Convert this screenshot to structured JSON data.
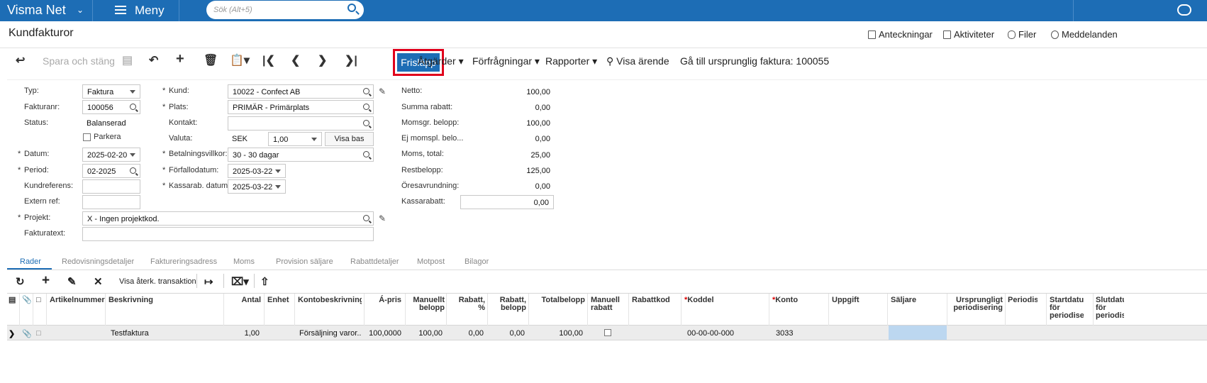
{
  "topbar": {
    "brand": "Visma Net",
    "menu_label": "Meny",
    "search_placeholder": "Sök (Alt+5)"
  },
  "page": {
    "title": "Kundfakturor",
    "links": [
      "Anteckningar",
      "Aktiviteter",
      "Filer",
      "Meddelanden"
    ]
  },
  "toolbar": {
    "save_close": "Spara och stäng",
    "release": "Frisläpp",
    "actions": "Åtgärder",
    "inquiries": "Förfrågningar",
    "reports": "Rapporter",
    "view_case": "Visa ärende",
    "goto_original": "Gå till ursprunglig faktura: 100055"
  },
  "form": {
    "typ_label": "Typ:",
    "typ_value": "Faktura",
    "fakturanr_label": "Fakturanr:",
    "fakturanr_value": "100056",
    "status_label": "Status:",
    "status_value": "Balanserad",
    "parkera_label": "Parkera",
    "datum_label": "Datum:",
    "datum_value": "2025-02-20",
    "period_label": "Period:",
    "period_value": "02-2025",
    "kundref_label": "Kundreferens:",
    "kundref_value": "",
    "extref_label": "Extern ref:",
    "extref_value": "",
    "projekt_label": "Projekt:",
    "projekt_value": "X - Ingen projektkod.",
    "fakturatext_label": "Fakturatext:",
    "fakturatext_value": "",
    "kund_label": "Kund:",
    "kund_value": "10022 - Confect AB",
    "plats_label": "Plats:",
    "plats_value": "PRIMÄR - Primärplats",
    "kontakt_label": "Kontakt:",
    "kontakt_value": "",
    "valuta_label": "Valuta:",
    "valuta_value": "SEK",
    "valuta_rate": "1,00",
    "visa_bas": "Visa bas",
    "betvillkor_label": "Betalningsvillkor:",
    "betvillkor_value": "30 - 30 dagar",
    "forfallo_label": "Förfallodatum:",
    "forfallo_value": "2025-03-22",
    "kassarab_label": "Kassarab. datum:",
    "kassarab_value": "2025-03-22"
  },
  "totals": {
    "netto_label": "Netto:",
    "netto": "100,00",
    "summa_rabatt_label": "Summa rabatt:",
    "summa_rabatt": "0,00",
    "momsgr_label": "Momsgr. belopp:",
    "momsgr": "100,00",
    "ejmoms_label": "Ej momspl. belo...",
    "ejmoms": "0,00",
    "moms_label": "Moms, total:",
    "moms": "25,00",
    "rest_label": "Restbelopp:",
    "rest": "125,00",
    "ores_label": "Öresavrundning:",
    "ores": "0,00",
    "kassarabatt_label": "Kassarabatt:",
    "kassarabatt": "0,00"
  },
  "tabs": [
    "Rader",
    "Redovisningsdetaljer",
    "Faktureringsadress",
    "Moms",
    "Provision säljare",
    "Rabattdetaljer",
    "Motpost",
    "Bilagor"
  ],
  "grid_toolbar": {
    "show_reversing": "Visa återk. transaktion"
  },
  "grid": {
    "headers": {
      "artikel": "Artikelnummer",
      "beskrivning": "Beskrivning",
      "antal": "Antal",
      "enhet": "Enhet",
      "kontobesk": "Kontobeskrivning",
      "apris": "Á-pris",
      "manuellt1": "Manuellt",
      "manuellt2": "belopp",
      "rabattp1": "Rabatt,",
      "rabattp2": "%",
      "rabattb1": "Rabatt,",
      "rabattb2": "belopp",
      "total": "Totalbelopp",
      "manrab1": "Manuell",
      "manrab2": "rabatt",
      "rabattkod": "Rabattkod",
      "koddel": "Koddel",
      "konto": "Konto",
      "uppgift": "Uppgift",
      "saljare": "Säljare",
      "ursp1": "Ursprungligt",
      "ursp2": "periodisering",
      "periodis": "Periodis",
      "start1": "Startdatum",
      "start2": "för",
      "start3": "periodisering",
      "slut1": "Slutdatum",
      "slut2": "för",
      "slut3": "periodisering"
    },
    "row": {
      "beskrivning": "Testfaktura",
      "antal": "1,00",
      "kontobesk": "Försäljning varor...",
      "apris": "100,0000",
      "manuellt": "100,00",
      "rabattp": "0,00",
      "rabattb": "0,00",
      "total": "100,00",
      "koddel": "00-00-00-000",
      "konto": "3033"
    }
  }
}
